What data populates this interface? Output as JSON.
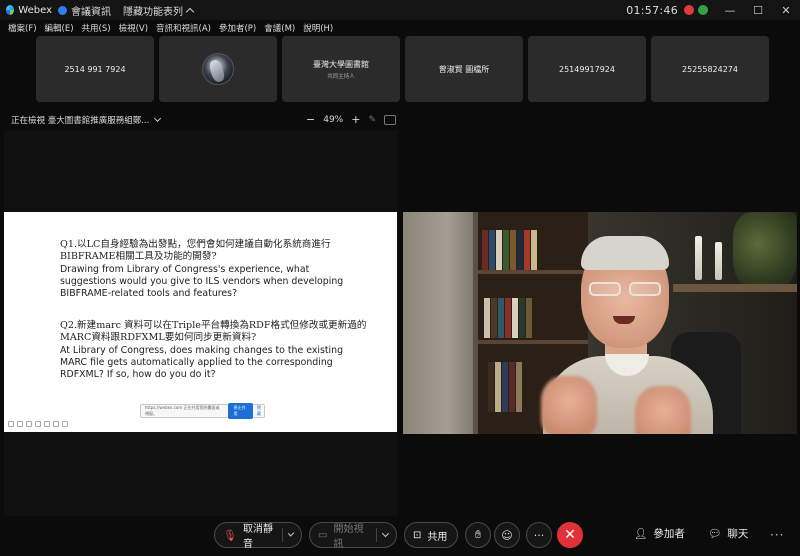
{
  "titlebar": {
    "app": "Webex",
    "meeting_info": "會議資訊",
    "hide_menu": "隱藏功能表列",
    "clock": "01:57:46",
    "minimize": "—",
    "maximize": "☐",
    "close": "✕"
  },
  "menu": [
    "檔案(F)",
    "編輯(E)",
    "共用(S)",
    "檢視(V)",
    "音訊和視訊(A)",
    "參加者(P)",
    "會議(M)",
    "說明(H)"
  ],
  "participants": [
    {
      "name": "2514 991 7924",
      "sub": ""
    },
    {
      "name": "",
      "sub": ""
    },
    {
      "name": "臺灣大學圖書館",
      "sub": "共同主持人"
    },
    {
      "name": "曾淑賢 圖檔所",
      "sub": ""
    },
    {
      "name": "25149917924",
      "sub": ""
    },
    {
      "name": "25255824274",
      "sub": ""
    }
  ],
  "share": {
    "label": "正在檢視 臺大圖書館推廣服務組鄭...",
    "zoom_minus": "−",
    "zoom_level": "49%",
    "zoom_plus": "+"
  },
  "slide": {
    "q1_zh": "Q1.以LC自身經驗為出發點，您們會如何建議自動化系統商進行BIBFRAME相關工具及功能的開發?",
    "q1_en": "Drawing from Library of Congress's experience, what suggestions would you give to ILS vendors when developing BIBFRAME-related tools and features?",
    "q2_zh": "Q2.新建marc 資料可以在Triple平台轉換為RDF格式但修改或更新過的MARC資料跟RDFXML要如何同步更新資料?",
    "q2_en": "At Library of Congress, does making changes to the existing MARC file gets automatically applied to the corresponding RDFXML? If so, how do you do it?",
    "popup_text": "https://webex.com 正在共用您的畫面或視窗。",
    "popup_button": "停止共用",
    "popup_hide": "隱藏"
  },
  "controls": {
    "unmute": "取消靜音",
    "start_video": "開始視訊",
    "share": "共用",
    "more": "···",
    "participants": "參加者",
    "chat": "聊天"
  },
  "colors": {
    "hangup": "#e0313a",
    "recording": "#e03a3a",
    "accent": "#2f7ff0"
  }
}
